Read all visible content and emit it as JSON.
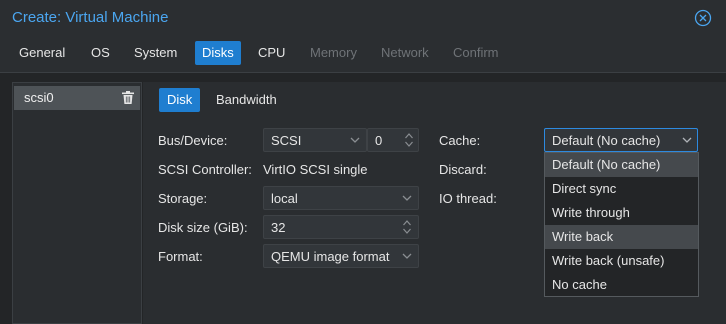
{
  "window": {
    "title": "Create: Virtual Machine",
    "close_icon": "close-circle-icon"
  },
  "tabs": [
    {
      "label": "General",
      "state": "enabled"
    },
    {
      "label": "OS",
      "state": "enabled"
    },
    {
      "label": "System",
      "state": "enabled"
    },
    {
      "label": "Disks",
      "state": "active"
    },
    {
      "label": "CPU",
      "state": "enabled"
    },
    {
      "label": "Memory",
      "state": "disabled"
    },
    {
      "label": "Network",
      "state": "disabled"
    },
    {
      "label": "Confirm",
      "state": "disabled"
    }
  ],
  "disk_list": {
    "items": [
      {
        "label": "scsi0",
        "icon": "trash-icon"
      }
    ]
  },
  "subtabs": [
    {
      "label": "Disk",
      "state": "active"
    },
    {
      "label": "Bandwidth",
      "state": "enabled"
    }
  ],
  "form": {
    "bus_device": {
      "label": "Bus/Device:",
      "bus": "SCSI",
      "device": "0"
    },
    "scsi_controller": {
      "label": "SCSI Controller:",
      "value": "VirtIO SCSI single"
    },
    "storage": {
      "label": "Storage:",
      "value": "local"
    },
    "disk_size": {
      "label": "Disk size (GiB):",
      "value": "32"
    },
    "format": {
      "label": "Format:",
      "value": "QEMU image format"
    },
    "cache": {
      "label": "Cache:",
      "value": "Default (No cache)"
    },
    "discard": {
      "label": "Discard:"
    },
    "io_thread": {
      "label": "IO thread:"
    }
  },
  "cache_dropdown": {
    "options": [
      {
        "label": "Default (No cache)",
        "state": "selected"
      },
      {
        "label": "Direct sync",
        "state": ""
      },
      {
        "label": "Write through",
        "state": ""
      },
      {
        "label": "Write back",
        "state": "hovered"
      },
      {
        "label": "Write back (unsafe)",
        "state": ""
      },
      {
        "label": "No cache",
        "state": ""
      }
    ]
  },
  "colors": {
    "accent": "#1f7ed0",
    "title": "#4ba6f0",
    "background": "#2b2e31"
  }
}
